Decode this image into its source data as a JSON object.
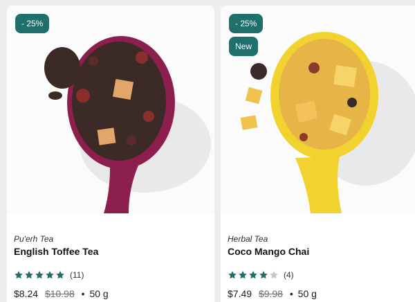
{
  "products": [
    {
      "badges": [
        "- 25%"
      ],
      "category": "Pu'erh Tea",
      "name": "English Toffee Tea",
      "rating": 5,
      "review_count": "(11)",
      "price": "$8.24",
      "old_price": "$10.98",
      "weight": "50 g",
      "spoon_color": "#8d1f4e",
      "leaf_color": "#3b2a26"
    },
    {
      "badges": [
        "- 25%",
        "New"
      ],
      "category": "Herbal Tea",
      "name": "Coco Mango Chai",
      "rating": 4,
      "review_count": "(4)",
      "price": "$7.49",
      "old_price": "$9.98",
      "weight": "50 g",
      "spoon_color": "#f1d22e",
      "leaf_color": "#e6b447"
    }
  ],
  "colors": {
    "badge_bg": "#1f6f6a",
    "star_filled": "#1f6f6a",
    "star_empty": "#c8c8c8"
  },
  "separator": "•"
}
